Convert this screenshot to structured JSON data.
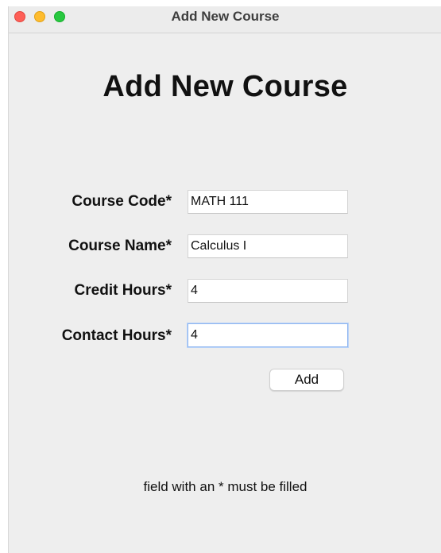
{
  "window": {
    "title": "Add New Course"
  },
  "heading": "Add New Course",
  "form": {
    "fields": [
      {
        "label": "Course Code*",
        "value": "MATH 111"
      },
      {
        "label": "Course Name*",
        "value": "Calculus I"
      },
      {
        "label": "Credit Hours*",
        "value": "4"
      },
      {
        "label": "Contact Hours*",
        "value": "4"
      }
    ],
    "add_label": "Add"
  },
  "footer_note": "field with an * must be filled",
  "colors": {
    "close": "#fe5f57",
    "minimize": "#febc2e",
    "maximize": "#28c840",
    "focus_ring": "#8fb6f0"
  }
}
